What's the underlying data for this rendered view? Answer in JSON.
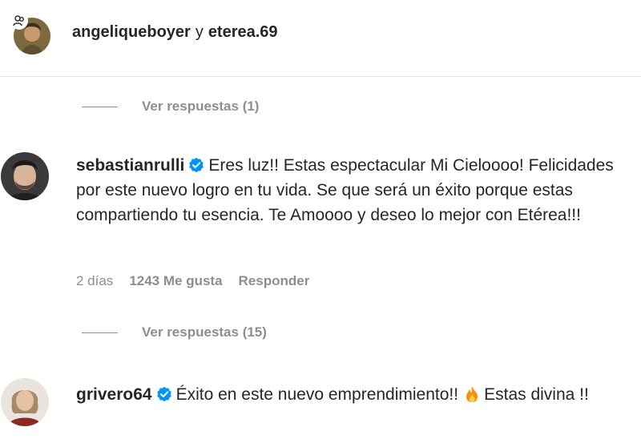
{
  "header": {
    "user1": "angeliqueboyer",
    "separator": "y",
    "user2": "eterea.69",
    "avatar_icon": "collab-users-icon"
  },
  "replies_1": {
    "label": "Ver respuestas (1)"
  },
  "comment_1": {
    "username": "sebastianrulli",
    "verified_icon": "verified-badge-icon",
    "text": "Eres luz!! Estas espectacular Mi Cieloooo! Felicidades por este nuevo logro en tu vida. Se que será un éxito porque estas compartiendo tu esencia. Te Amoooo y deseo lo mejor con Etérea!!!",
    "time": "2 días",
    "likes": "1243 Me gusta",
    "reply_label": "Responder"
  },
  "replies_2": {
    "label": "Ver respuestas (15)"
  },
  "comment_2": {
    "username": "grivero64",
    "verified_icon": "verified-badge-icon",
    "text_before": "Éxito en este nuevo emprendimiento!!",
    "emoji_icon": "fire-emoji-icon",
    "text_after": "Estas divina !!"
  },
  "colors": {
    "text": "#262626",
    "secondary": "#8e8e8e",
    "verified": "#0095f6",
    "divider": "#e4e4e4"
  }
}
